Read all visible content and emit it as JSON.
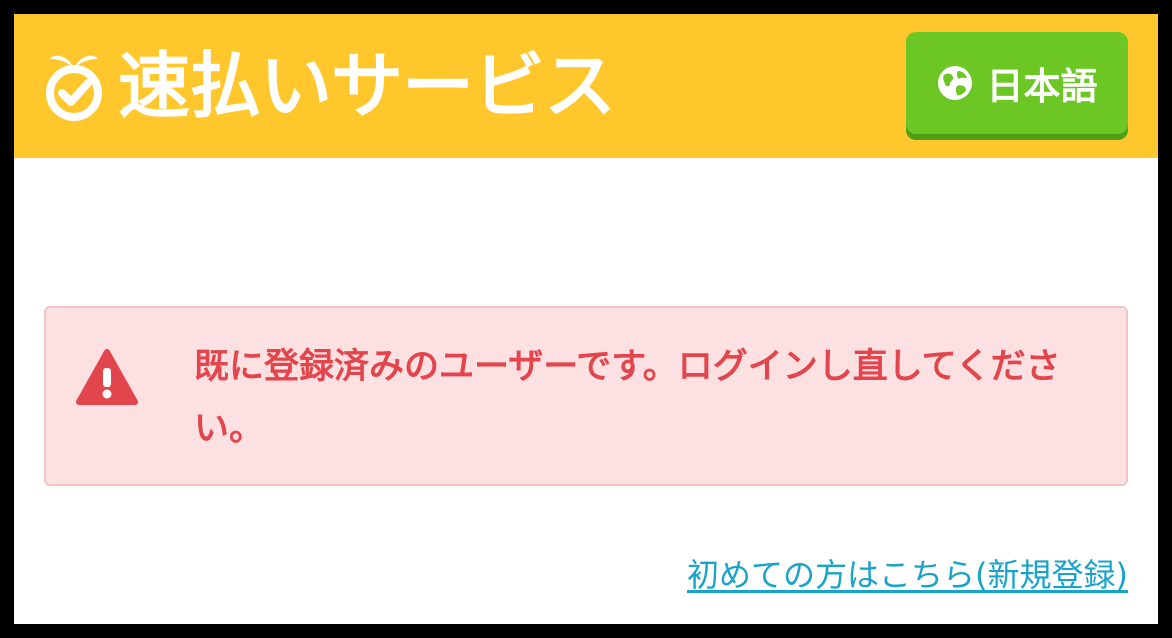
{
  "header": {
    "brand_title": "速払いサービス",
    "brand_icon": "stopwatch-check-icon",
    "language_button": {
      "label": "日本語",
      "icon": "globe-icon"
    }
  },
  "alert": {
    "icon": "warning-icon",
    "message": "既に登録済みのユーザーです。ログインし直してください。"
  },
  "links": {
    "register": "初めての方はこちら(新規登録)"
  },
  "colors": {
    "header_bg": "#ffc72c",
    "language_button_bg": "#6cc624",
    "alert_bg": "#fde0e1",
    "alert_text": "#e2454c",
    "link": "#1aa3c9"
  }
}
